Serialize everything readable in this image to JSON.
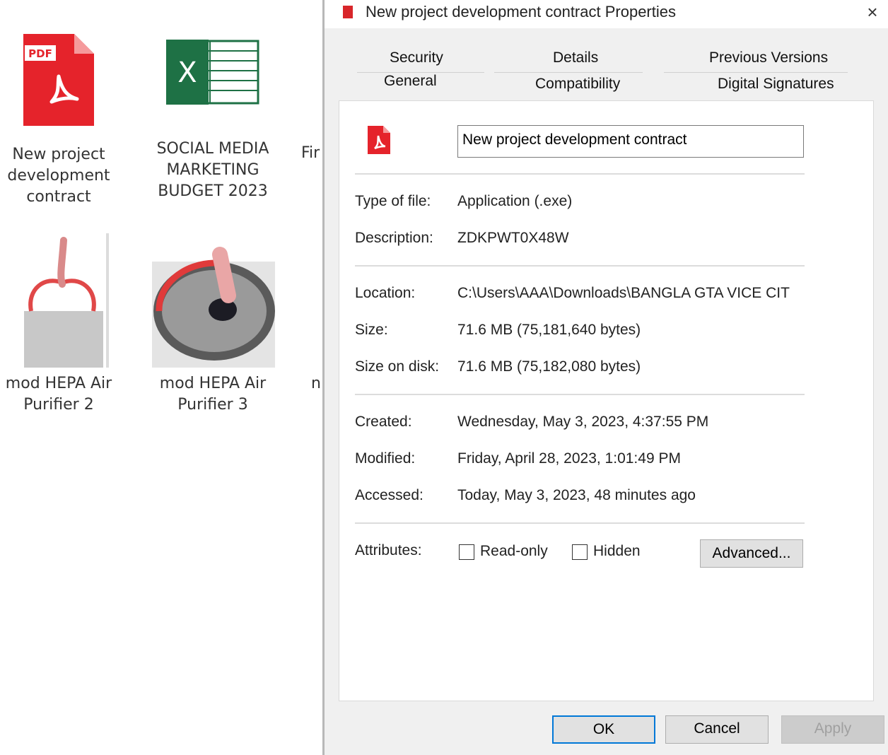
{
  "desktop": {
    "items": [
      {
        "label_lines": [
          "New project",
          "development",
          "contract"
        ],
        "icon": "pdf-icon"
      },
      {
        "label_lines": [
          "SOCIAL MEDIA",
          "MARKETING",
          "BUDGET 2023"
        ],
        "icon": "excel-icon"
      },
      {
        "label_partial": "Fir"
      },
      {
        "label_lines": [
          "mod HEPA Air",
          "Purifier 2"
        ],
        "icon": "air-purifier-thumbnail"
      },
      {
        "label_lines": [
          "mod HEPA Air",
          "Purifier 3"
        ],
        "icon": "air-purifier-thumbnail"
      },
      {
        "label_partial": "n"
      }
    ],
    "pdf_badge": "PDF",
    "excel_badge": "X"
  },
  "dialog": {
    "title": "New project development contract Properties",
    "close_glyph": "×",
    "tabs": {
      "security": "Security",
      "details": "Details",
      "previous_versions": "Previous Versions",
      "general": "General",
      "compatibility": "Compatibility",
      "digital_signatures": "Digital Signatures"
    },
    "file_name": "New project development contract",
    "type_of_file": {
      "label": "Type of file:",
      "value": "Application (.exe)"
    },
    "description": {
      "label": "Description:",
      "value": "ZDKPWT0X48W"
    },
    "location": {
      "label": "Location:",
      "value": "C:\\Users\\AAA\\Downloads\\BANGLA GTA VICE CIT"
    },
    "size": {
      "label": "Size:",
      "value": "71.6 MB (75,181,640 bytes)"
    },
    "size_on_disk": {
      "label": "Size on disk:",
      "value": "71.6 MB (75,182,080 bytes)"
    },
    "created": {
      "label": "Created:",
      "value": "Wednesday, May 3, 2023, 4:37:55 PM"
    },
    "modified": {
      "label": "Modified:",
      "value": "Friday, April 28, 2023, 1:01:49 PM"
    },
    "accessed": {
      "label": "Accessed:",
      "value": "Today, May 3, 2023, 48 minutes ago"
    },
    "attributes": {
      "label": "Attributes:",
      "read_only": "Read-only",
      "hidden": "Hidden",
      "advanced": "Advanced..."
    },
    "buttons": {
      "ok": "OK",
      "cancel": "Cancel",
      "apply": "Apply"
    },
    "colors": {
      "pdf_red": "#d8262a",
      "excel_green": "#1e7145",
      "ok_border": "#0078d7"
    }
  }
}
